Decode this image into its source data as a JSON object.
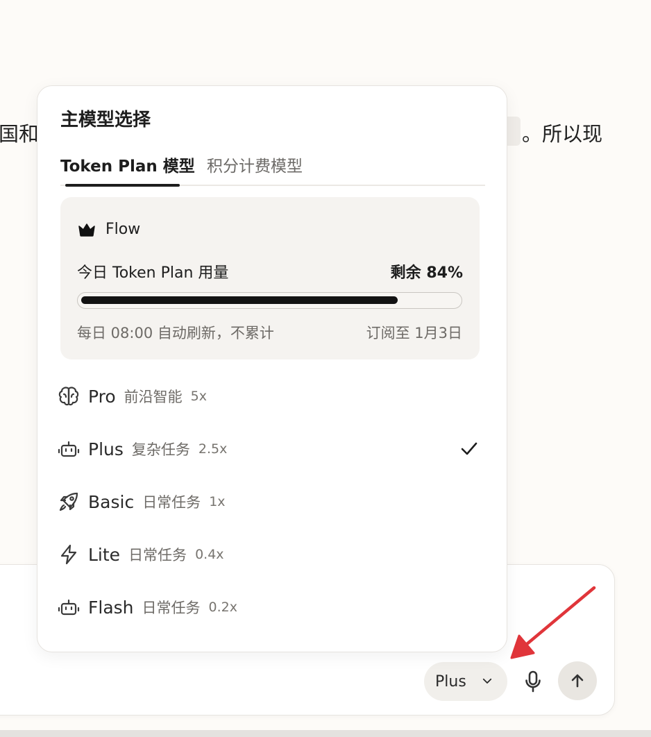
{
  "background": {
    "text_left_top": "国和",
    "text_right_top": "。所以现",
    "text_left_mid": "。"
  },
  "popup": {
    "title": "主模型选择",
    "tabs": [
      {
        "label": "Token Plan 模型",
        "active": true
      },
      {
        "label": "积分计费模型",
        "active": false
      }
    ],
    "plan": {
      "icon": "crown-icon",
      "name": "Flow",
      "usage_label": "今日 Token Plan 用量",
      "remaining_label": "剩余 84%",
      "remaining_fraction": 0.84,
      "refresh_note": "每日 08:00 自动刷新，不累计",
      "subscribe_note": "订阅至 1月3日"
    },
    "models": [
      {
        "icon": "brain-icon",
        "name": "Pro",
        "desc": "前沿智能",
        "mult": "5x",
        "selected": false
      },
      {
        "icon": "robot-icon",
        "name": "Plus",
        "desc": "复杂任务",
        "mult": "2.5x",
        "selected": true
      },
      {
        "icon": "rocket-icon",
        "name": "Basic",
        "desc": "日常任务",
        "mult": "1x",
        "selected": false
      },
      {
        "icon": "lightning-icon",
        "name": "Lite",
        "desc": "日常任务",
        "mult": "0.4x",
        "selected": false
      },
      {
        "icon": "robot-icon",
        "name": "Flash",
        "desc": "日常任务",
        "mult": "0.2x",
        "selected": false
      }
    ]
  },
  "composer": {
    "model_selector": "Plus",
    "icons": [
      "chevron-down-icon",
      "microphone-icon",
      "arrow-up-icon"
    ]
  },
  "colors": {
    "background": "#fdfbf8",
    "annotation_arrow": "#e0353a",
    "progress_fill": "#121212"
  }
}
